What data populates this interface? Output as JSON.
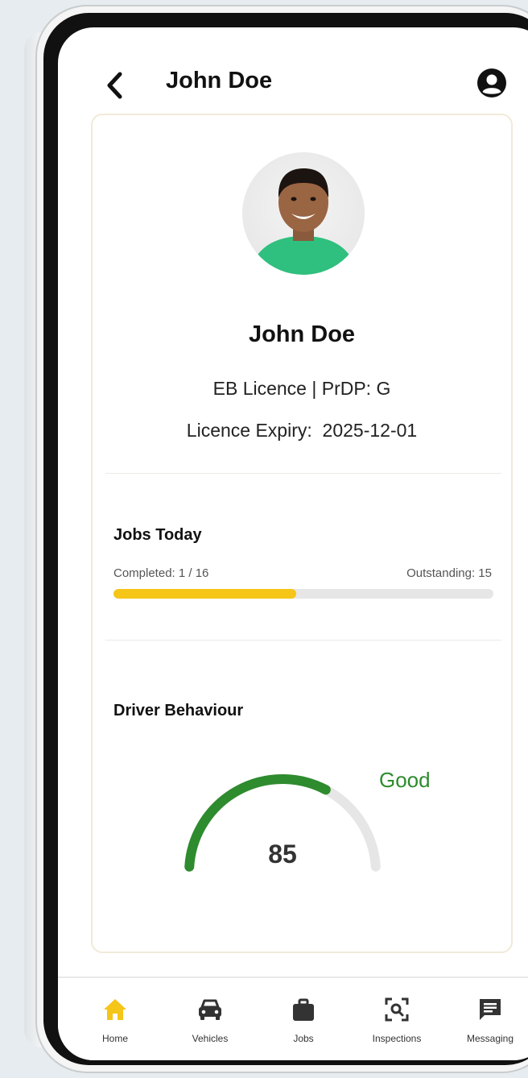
{
  "header": {
    "title": "John Doe"
  },
  "profile": {
    "name": "John Doe",
    "licence": "EB Licence | PrDP: G",
    "expiry": "Licence Expiry:  2025-12-01"
  },
  "jobs_today": {
    "title": "Jobs Today",
    "completed_label": "Completed: 1 / 16",
    "outstanding_label": "Outstanding: 15",
    "progress_fraction": 0.48
  },
  "driver_behaviour": {
    "title": "Driver Behaviour",
    "score": "85",
    "score_value": 85,
    "rating": "Good"
  },
  "nav": {
    "items": [
      {
        "label": "Home",
        "icon": "home-icon",
        "active": true
      },
      {
        "label": "Vehicles",
        "icon": "car-icon"
      },
      {
        "label": "Jobs",
        "icon": "briefcase-icon"
      },
      {
        "label": "Inspections",
        "icon": "scan-icon"
      },
      {
        "label": "Messaging",
        "icon": "message-icon"
      }
    ]
  },
  "colors": {
    "accent": "#f5c518",
    "good": "#2e8b2e",
    "track": "#e6e6e6"
  }
}
